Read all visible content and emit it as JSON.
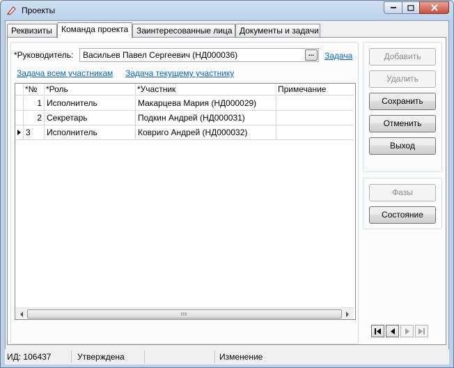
{
  "window": {
    "title": "Проекты"
  },
  "tabs": [
    {
      "label": "Реквизиты"
    },
    {
      "label": "Команда проекта"
    },
    {
      "label": "Заинтересованные лица"
    },
    {
      "label": "Документы и задачи"
    }
  ],
  "form": {
    "manager_label": "*Руководитель:",
    "manager_value": "Васильев Павел Сергеевич (НД000036)",
    "browse_label": "...",
    "task_link": "Задача",
    "task_all_link": "Задача всем участникам",
    "task_current_link": "Задача текущему участнику"
  },
  "grid": {
    "columns": [
      "*№",
      "*Роль",
      "*Участник",
      "Примечание"
    ],
    "rows": [
      {
        "num": "1",
        "role": "Исполнитель",
        "member": "Макарцева Мария (НД000029)",
        "note": ""
      },
      {
        "num": "2",
        "role": "Секретарь",
        "member": "Подкин Андрей (НД000031)",
        "note": ""
      },
      {
        "num": "3",
        "role": "Исполнитель",
        "member": "Ковриго Андрей (НД000032)",
        "note": ""
      }
    ]
  },
  "buttons": {
    "add": "Добавить",
    "delete": "Удалить",
    "save": "Сохранить",
    "cancel": "Отменить",
    "exit": "Выход",
    "phases": "Фазы",
    "state": "Состояние"
  },
  "status": {
    "id": "ИД: 106437",
    "state": "Утверждена",
    "empty": "",
    "mode": "Изменение"
  },
  "colors": {
    "link": "#0066cc",
    "disabled_text": "#8d8d8d"
  }
}
